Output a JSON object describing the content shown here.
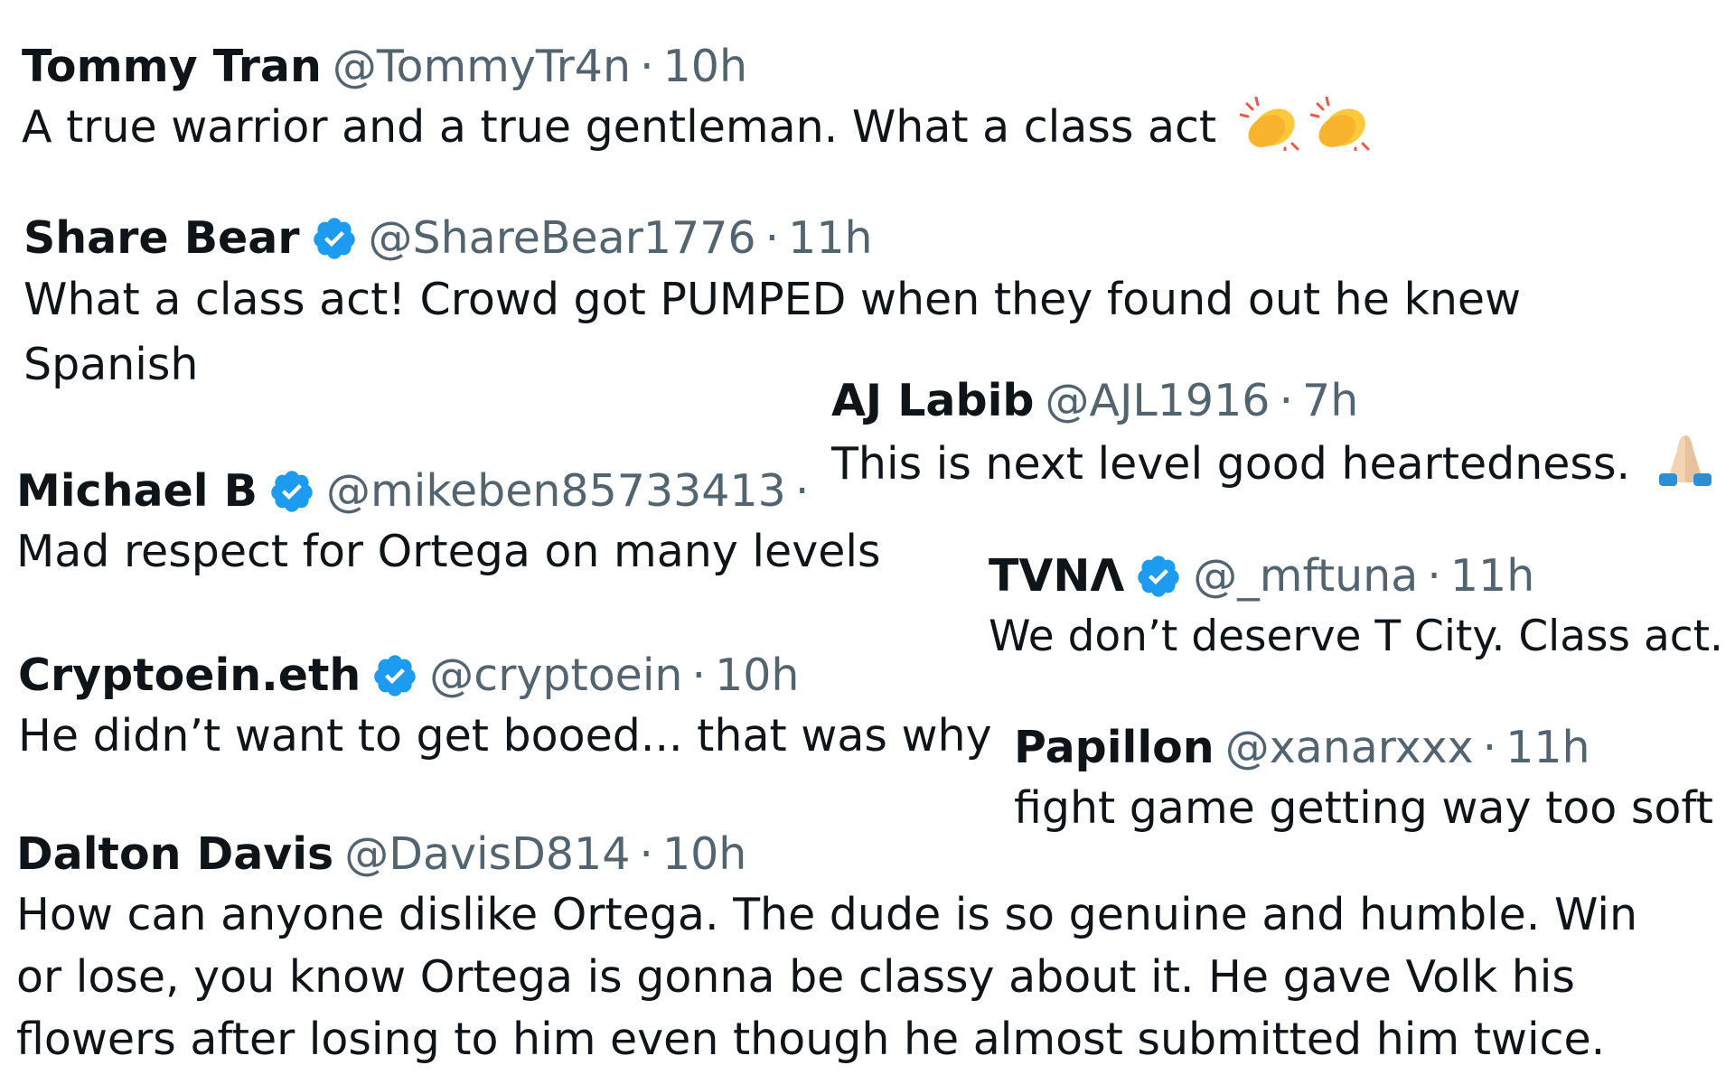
{
  "tweets": [
    {
      "name": "Tommy Tran",
      "handle": "@TommyTr4n",
      "separator": "·",
      "time": "10h",
      "text": "A true warrior and a true gentleman. What a class act",
      "emoji": [
        "clapping-hands",
        "clapping-hands"
      ]
    },
    {
      "name": "Share Bear",
      "verified": true,
      "handle": "@ShareBear1776",
      "separator": "·",
      "time": "11h",
      "text": "What a class act! Crowd got PUMPED when they found out he knew Spanish"
    },
    {
      "name": "AJ Labib",
      "handle": "@AJL1916",
      "separator": "·",
      "time": "7h",
      "text": "This is next level good heartedness.",
      "emoji": [
        "folded-hands"
      ]
    },
    {
      "name": "Michael B",
      "verified": true,
      "handle": "@mikeben85733413",
      "separator": "·",
      "text": "Mad respect for Ortega on many levels"
    },
    {
      "name": "TVNΛ",
      "verified": true,
      "handle": "@_mftuna",
      "separator": "·",
      "time": "11h",
      "text": "We don’t deserve T City. Class act."
    },
    {
      "name": "Cryptoein.eth",
      "verified": true,
      "handle": "@cryptoein",
      "separator": "·",
      "time": "10h",
      "text": "He didn’t want to get booed... that was why"
    },
    {
      "name": "Papillon",
      "handle": "@xanarxxx",
      "separator": "·",
      "time": "11h",
      "text": "fight game getting way too soft"
    },
    {
      "name": "Dalton Davis",
      "handle": "@DavisD814",
      "separator": "·",
      "time": "10h",
      "text": "How can anyone dislike Ortega. The dude is so genuine and humble. Win or lose, you know Ortega is gonna be classy about it. He gave Volk his flowers after losing to him even though he almost submitted him twice."
    }
  ],
  "colors": {
    "name": "#0f1419",
    "muted": "#536471",
    "verified_badge": "#1d9bf0",
    "emoji_yellow": "#ffc83d"
  }
}
